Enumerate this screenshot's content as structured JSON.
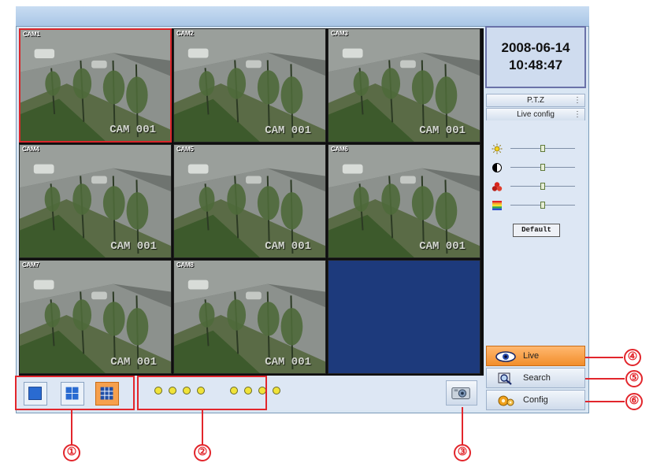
{
  "grid": {
    "cells": [
      {
        "label": "CAM1",
        "overlay": "CAM 001"
      },
      {
        "label": "CAM2",
        "overlay": "CAM 001"
      },
      {
        "label": "CAM3",
        "overlay": "CAM 001"
      },
      {
        "label": "CAM4",
        "overlay": "CAM 001"
      },
      {
        "label": "CAM5",
        "overlay": "CAM 001"
      },
      {
        "label": "CAM6",
        "overlay": "CAM 001"
      },
      {
        "label": "CAM7",
        "overlay": "CAM 001"
      },
      {
        "label": "CAM8",
        "overlay": "CAM 001"
      }
    ]
  },
  "datetime": {
    "date": "2008-06-14",
    "time": "10:48:47"
  },
  "panel": {
    "ptz_label": "P.T.Z",
    "liveconfig_label": "Live config",
    "menu_glyph": "⋮",
    "sliders": [
      {
        "name": "brightness",
        "icon": "sun-icon",
        "level": 0.5
      },
      {
        "name": "contrast",
        "icon": "contrast-icon",
        "level": 0.5
      },
      {
        "name": "saturation",
        "icon": "color-balls-icon",
        "level": 0.5
      },
      {
        "name": "hue",
        "icon": "rainbow-icon",
        "level": 0.5
      }
    ],
    "default_label": "Default"
  },
  "nav": {
    "live": "Live",
    "search": "Search",
    "config": "Config",
    "active": "live"
  },
  "bottom": {
    "layouts": [
      "single",
      "quad",
      "nine"
    ],
    "active_layout": "nine",
    "channel_dots": 8
  },
  "annotations": [
    "①",
    "②",
    "③",
    "④",
    "⑤",
    "⑥"
  ],
  "colors": {
    "accent": "#f28e2b",
    "annotation": "#e2262c",
    "empty_cell": "#1d3a7c",
    "channel_dot": "#f0e33a"
  }
}
